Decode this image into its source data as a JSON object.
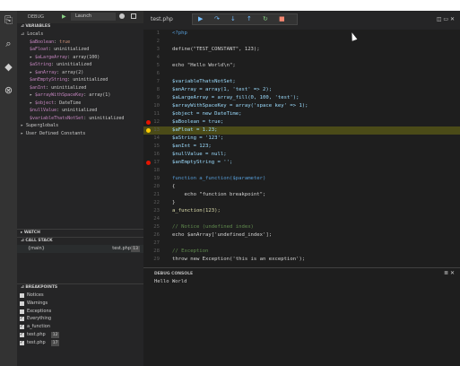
{
  "debug": {
    "title": "DEBUG",
    "config": "Launch",
    "sections": {
      "variables": "VARIABLES",
      "watch": "WATCH",
      "call_stack": "CALL STACK",
      "breakpoints": "BREAKPOINTS"
    },
    "variables": [
      {
        "prefix": "⊿ ",
        "name": "Locals",
        "sep": "",
        "value": ""
      },
      {
        "prefix": "",
        "name": "$aBoolean",
        "sep": ": ",
        "value": "true"
      },
      {
        "prefix": "",
        "name": "$aFloat",
        "sep": ": ",
        "value": "uninitialized"
      },
      {
        "prefix": "▸ ",
        "name": "$aLargeArray",
        "sep": ": ",
        "value": "array(100)"
      },
      {
        "prefix": "",
        "name": "$aString",
        "sep": ": ",
        "value": "uninitialized"
      },
      {
        "prefix": "▸ ",
        "name": "$anArray",
        "sep": ": ",
        "value": "array(2)"
      },
      {
        "prefix": "",
        "name": "$anEmptyString",
        "sep": ": ",
        "value": "uninitialized"
      },
      {
        "prefix": "",
        "name": "$anInt",
        "sep": ": ",
        "value": "uninitialized"
      },
      {
        "prefix": "▸ ",
        "name": "$arrayWithSpaceKey",
        "sep": ": ",
        "value": "array(1)"
      },
      {
        "prefix": "▸ ",
        "name": "$object",
        "sep": ": ",
        "value": "DateTime"
      },
      {
        "prefix": "",
        "name": "$nullValue",
        "sep": ": ",
        "value": "uninitialized"
      },
      {
        "prefix": "",
        "name": "$variableThatsNotSet",
        "sep": ": ",
        "value": "uninitialized"
      },
      {
        "prefix": "▸ ",
        "name": "Superglobals",
        "sep": "",
        "value": ""
      },
      {
        "prefix": "▸ ",
        "name": "User Defined Constants",
        "sep": "",
        "value": ""
      }
    ],
    "call_stack": [
      {
        "name": "{main}",
        "file": "test.php",
        "line": "13"
      }
    ],
    "breakpoints": [
      {
        "label": "Notices",
        "checked": false,
        "line": ""
      },
      {
        "label": "Warnings",
        "checked": false,
        "line": ""
      },
      {
        "label": "Exceptions",
        "checked": false,
        "line": ""
      },
      {
        "label": "Everything",
        "checked": true,
        "line": ""
      },
      {
        "label": "a_function",
        "checked": true,
        "line": ""
      },
      {
        "label": "test.php",
        "checked": true,
        "line": "12"
      },
      {
        "label": "test.php",
        "checked": true,
        "line": "17"
      }
    ]
  },
  "editor": {
    "tab": "test.php",
    "code": [
      {
        "n": "1",
        "t": "<?php",
        "c": "kw",
        "bp": ""
      },
      {
        "n": "2",
        "t": "",
        "c": "plain",
        "bp": ""
      },
      {
        "n": "3",
        "t": "define(\"TEST_CONSTANT\", 123);",
        "c": "plain",
        "bp": ""
      },
      {
        "n": "4",
        "t": "",
        "c": "plain",
        "bp": ""
      },
      {
        "n": "5",
        "t": "echo \"Hello World\\n\";",
        "c": "plain",
        "bp": ""
      },
      {
        "n": "6",
        "t": "",
        "c": "plain",
        "bp": ""
      },
      {
        "n": "7",
        "t": "$variableThatsNotSet;",
        "c": "var2",
        "bp": ""
      },
      {
        "n": "8",
        "t": "$anArray = array(1, 'test' => 2);",
        "c": "var2",
        "bp": ""
      },
      {
        "n": "9",
        "t": "$aLargeArray = array_fill(0, 100, 'test');",
        "c": "var2",
        "bp": ""
      },
      {
        "n": "10",
        "t": "$arrayWithSpaceKey = array('space key' => 1);",
        "c": "var2",
        "bp": ""
      },
      {
        "n": "11",
        "t": "$object = new DateTime;",
        "c": "var2",
        "bp": ""
      },
      {
        "n": "12",
        "t": "$aBoolean = true;",
        "c": "var2",
        "bp": "red"
      },
      {
        "n": "13",
        "t": "$aFloat = 1.23;",
        "c": "var2",
        "bp": "current"
      },
      {
        "n": "14",
        "t": "$aString = '123';",
        "c": "var2",
        "bp": ""
      },
      {
        "n": "15",
        "t": "$anInt = 123;",
        "c": "var2",
        "bp": ""
      },
      {
        "n": "16",
        "t": "$nullValue = null;",
        "c": "var2",
        "bp": ""
      },
      {
        "n": "17",
        "t": "$anEmptyString = '';",
        "c": "var2",
        "bp": "red"
      },
      {
        "n": "18",
        "t": "",
        "c": "plain",
        "bp": ""
      },
      {
        "n": "19",
        "t": "function a_function($parameter)",
        "c": "kw",
        "bp": ""
      },
      {
        "n": "20",
        "t": "{",
        "c": "plain",
        "bp": ""
      },
      {
        "n": "21",
        "t": "    echo \"function breakpoint\";",
        "c": "plain",
        "bp": ""
      },
      {
        "n": "22",
        "t": "}",
        "c": "plain",
        "bp": ""
      },
      {
        "n": "23",
        "t": "a_function(123);",
        "c": "fn",
        "bp": ""
      },
      {
        "n": "24",
        "t": "",
        "c": "plain",
        "bp": ""
      },
      {
        "n": "25",
        "t": "// Notice (undefined index)",
        "c": "com",
        "bp": ""
      },
      {
        "n": "26",
        "t": "echo $anArray['undefined_index'];",
        "c": "plain",
        "bp": ""
      },
      {
        "n": "27",
        "t": "",
        "c": "plain",
        "bp": ""
      },
      {
        "n": "28",
        "t": "// Exception",
        "c": "com",
        "bp": ""
      },
      {
        "n": "29",
        "t": "throw new Exception('this is an exception');",
        "c": "plain",
        "bp": ""
      }
    ]
  },
  "console": {
    "title": "DEBUG CONSOLE",
    "output": "Hello World"
  }
}
